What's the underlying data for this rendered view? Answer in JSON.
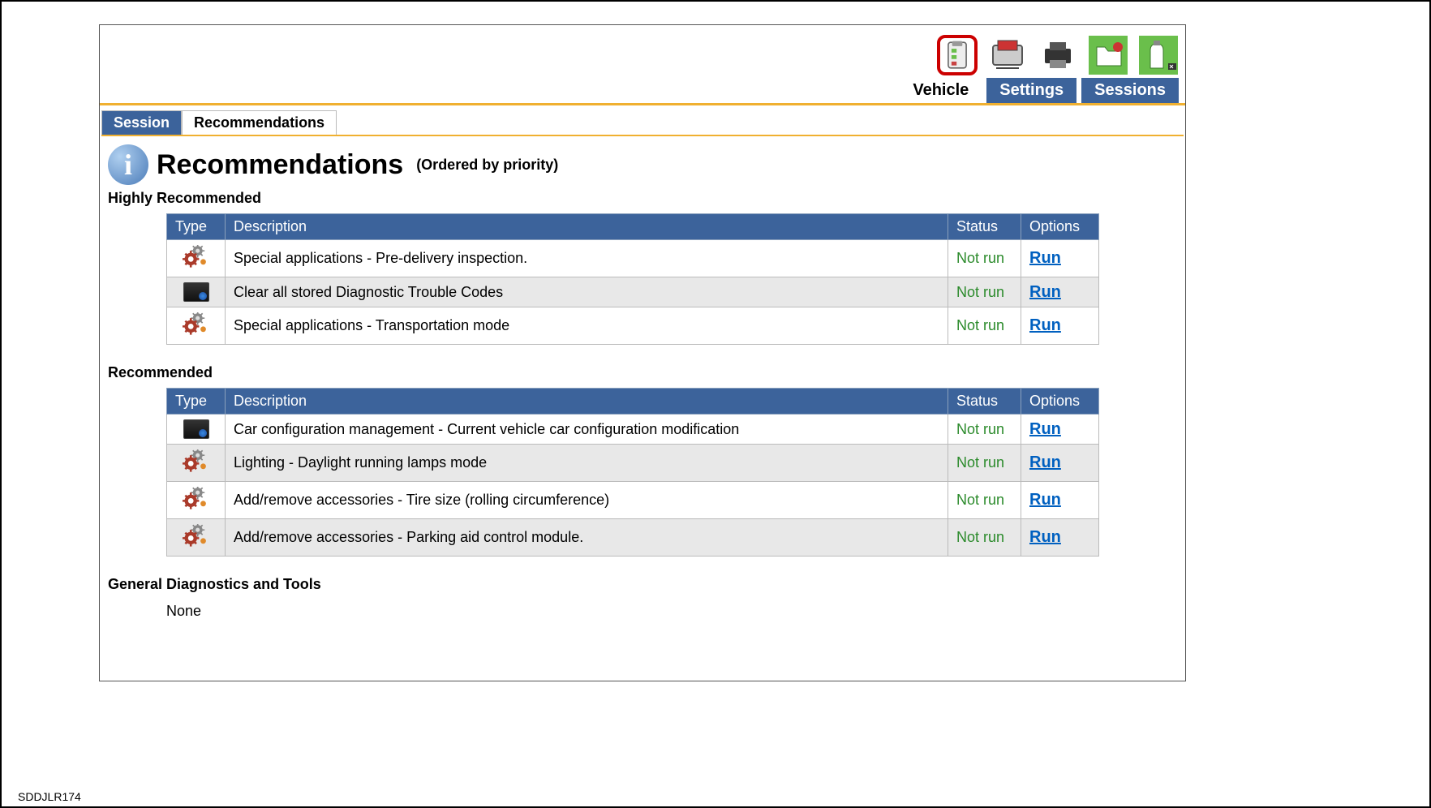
{
  "reference_code": "SDDJLR174",
  "top_tabs": {
    "vehicle": "Vehicle",
    "settings": "Settings",
    "sessions": "Sessions"
  },
  "sub_tabs": {
    "session": "Session",
    "recommendations": "Recommendations"
  },
  "heading": {
    "title": "Recommendations",
    "subtitle": "(Ordered by priority)"
  },
  "columns": {
    "type": "Type",
    "description": "Description",
    "status": "Status",
    "options": "Options"
  },
  "run_label": "Run",
  "sections": {
    "highly": {
      "title": "Highly Recommended",
      "rows": [
        {
          "icon": "gear",
          "description": "Special applications - Pre-delivery inspection.",
          "status": "Not run"
        },
        {
          "icon": "screen",
          "description": "Clear all stored Diagnostic Trouble Codes",
          "status": "Not run"
        },
        {
          "icon": "gear",
          "description": "Special applications - Transportation mode",
          "status": "Not run"
        }
      ]
    },
    "recommended": {
      "title": "Recommended",
      "rows": [
        {
          "icon": "screen",
          "description": "Car configuration management - Current vehicle car configuration modification",
          "status": "Not run"
        },
        {
          "icon": "gear",
          "description": "Lighting - Daylight running lamps mode",
          "status": "Not run"
        },
        {
          "icon": "gear",
          "description": "Add/remove accessories - Tire size (rolling circumference)",
          "status": "Not run"
        },
        {
          "icon": "gear",
          "description": "Add/remove accessories - Parking aid control module.",
          "status": "Not run"
        }
      ]
    },
    "general": {
      "title": "General Diagnostics and Tools",
      "none": "None"
    }
  }
}
